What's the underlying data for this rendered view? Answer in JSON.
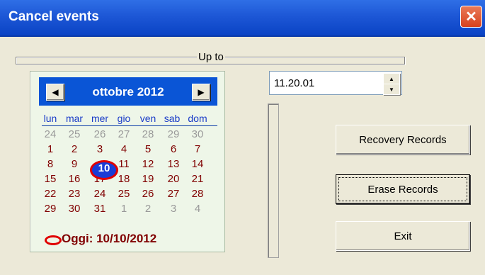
{
  "window": {
    "title": "Cancel events",
    "close_glyph": "✕"
  },
  "group": {
    "label": "Up to"
  },
  "calendar": {
    "month_label": "ottobre 2012",
    "prev_glyph": "◀",
    "next_glyph": "▶",
    "weekdays": [
      "lun",
      "mar",
      "mer",
      "gio",
      "ven",
      "sab",
      "dom"
    ],
    "weeks": [
      [
        "24",
        "25",
        "26",
        "27",
        "28",
        "29",
        "30"
      ],
      [
        "1",
        "2",
        "3",
        "4",
        "5",
        "6",
        "7"
      ],
      [
        "8",
        "9",
        "10",
        "11",
        "12",
        "13",
        "14"
      ],
      [
        "15",
        "16",
        "17",
        "18",
        "19",
        "20",
        "21"
      ],
      [
        "22",
        "23",
        "24",
        "25",
        "26",
        "27",
        "28"
      ],
      [
        "29",
        "30",
        "31",
        "1",
        "2",
        "3",
        "4"
      ]
    ],
    "selected_day": "10",
    "today_label": "Oggi: 10/10/2012"
  },
  "time": {
    "value": "11.20.01",
    "up_glyph": "▲",
    "down_glyph": "▼"
  },
  "buttons": {
    "recovery": "Recovery Records",
    "erase": "Erase Records",
    "exit": "Exit"
  },
  "colors": {
    "title_bar": "#0a55d6",
    "day_text": "#800000",
    "today_mark": "#e00000",
    "weekday_text": "#1a3cc8"
  }
}
